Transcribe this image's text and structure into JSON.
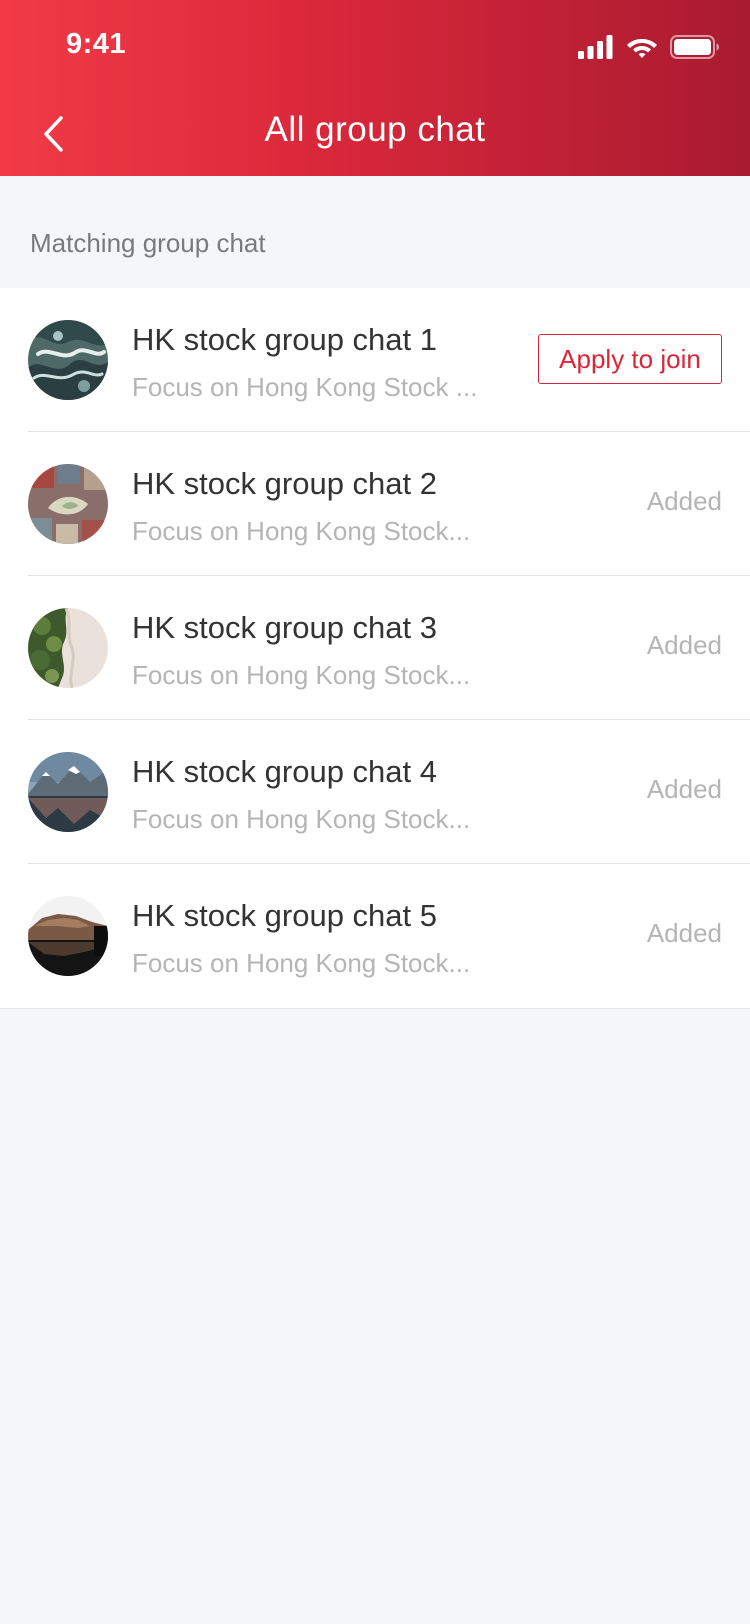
{
  "status_bar": {
    "time": "9:41"
  },
  "nav": {
    "title": "All group chat",
    "back_icon": "chevron-left-icon"
  },
  "section": {
    "title": "Matching group chat"
  },
  "groups": [
    {
      "name": "HK stock group chat 1",
      "description": "Focus on Hong Kong Stock ...",
      "action": "Apply to join",
      "status": "apply"
    },
    {
      "name": "HK stock group chat 2",
      "description": "Focus on Hong Kong Stock...",
      "action": "Added",
      "status": "added"
    },
    {
      "name": "HK stock group chat 3",
      "description": "Focus on Hong Kong Stock...",
      "action": "Added",
      "status": "added"
    },
    {
      "name": "HK stock group chat 4",
      "description": "Focus on Hong Kong Stock...",
      "action": "Added",
      "status": "added"
    },
    {
      "name": "HK stock group chat 5",
      "description": "Focus on Hong Kong Stock...",
      "action": "Added",
      "status": "added"
    }
  ],
  "colors": {
    "header_start": "#f23a47",
    "header_end": "#a91b30",
    "accent": "#d8273a",
    "background": "#f5f6f8",
    "title_text": "#333333",
    "muted_text": "#b5b5b5"
  }
}
